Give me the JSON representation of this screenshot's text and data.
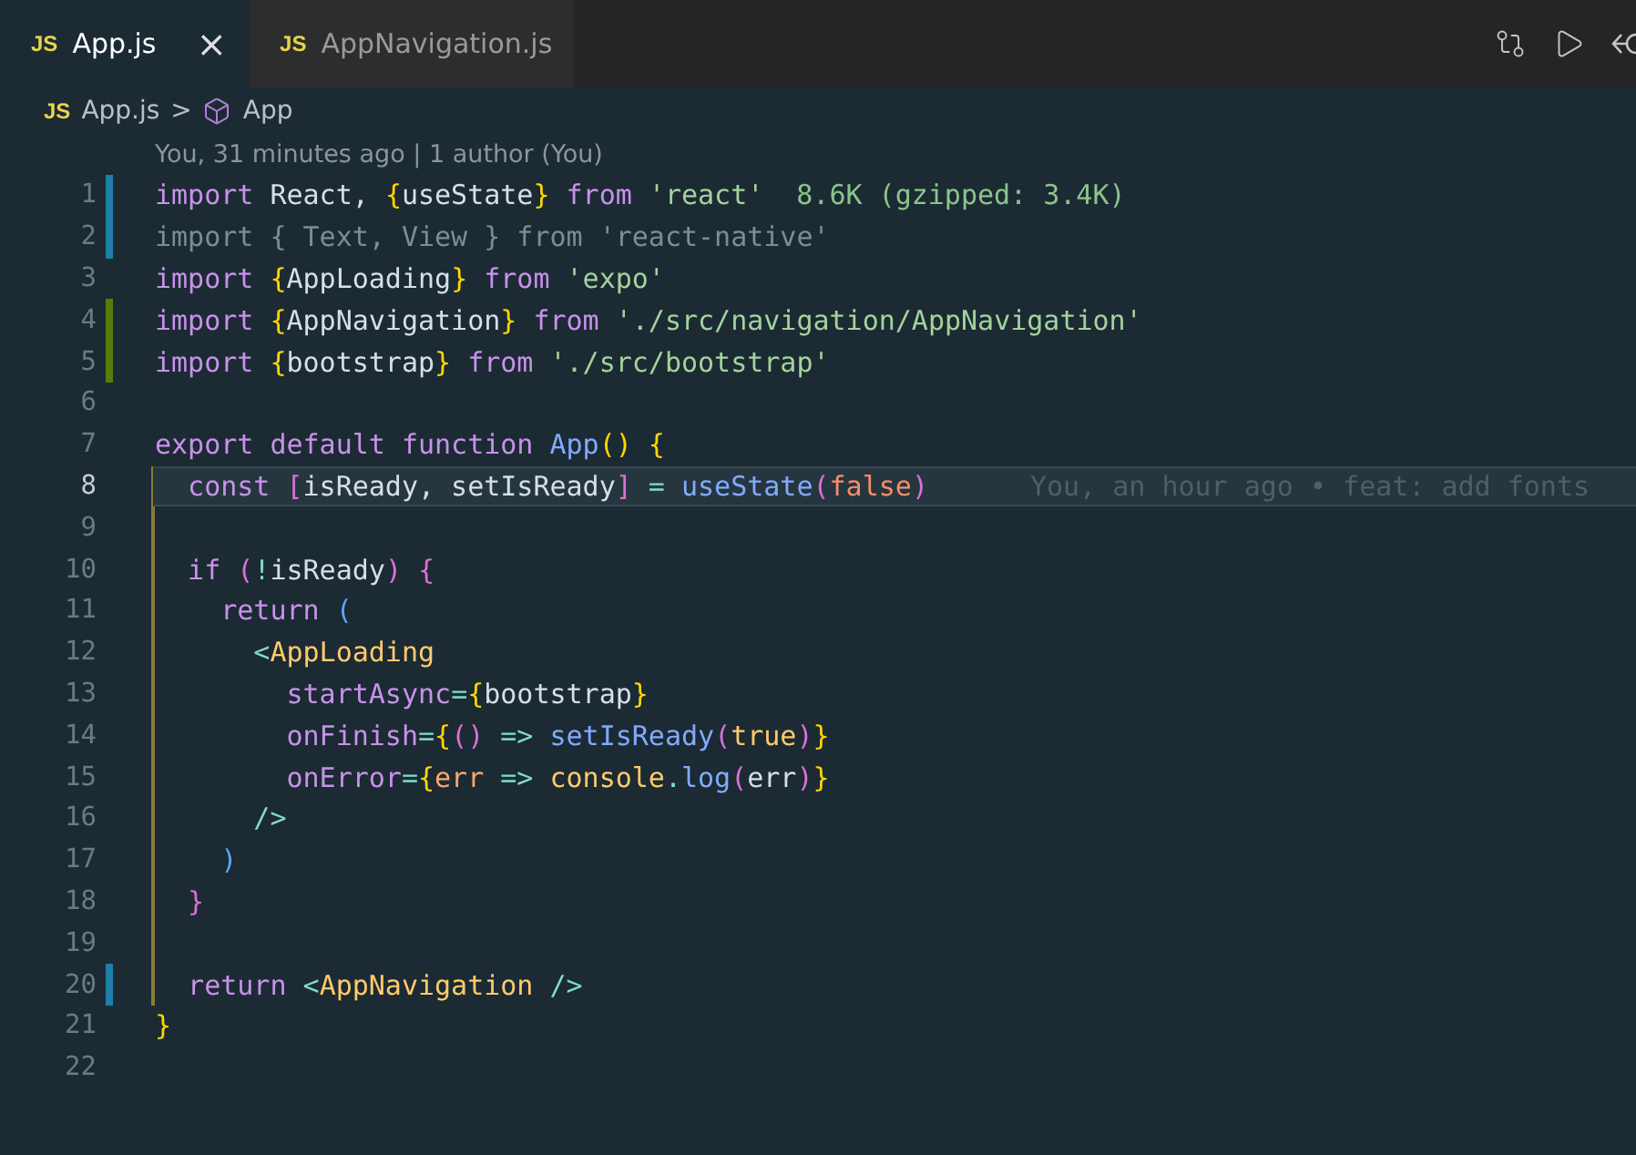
{
  "tabs": [
    {
      "icon_text": "JS",
      "label": "App.js",
      "selected": true,
      "close": "×"
    },
    {
      "icon_text": "JS",
      "label": "AppNavigation.js",
      "selected": false
    }
  ],
  "breadcrumb": {
    "file_icon_text": "JS",
    "file": "App.js",
    "separator": ">",
    "symbol": "App"
  },
  "blame_header": "You, 31 minutes ago | 1 author (You)",
  "lines": [
    {
      "number": "1",
      "modified": true,
      "added": false,
      "current": false,
      "guide": false,
      "tokens": [
        {
          "kind": "kw",
          "text": "import "
        },
        {
          "kind": "plain",
          "text": "React, "
        },
        {
          "kind": "brace",
          "text": "{"
        },
        {
          "kind": "plain",
          "text": "useState"
        },
        {
          "kind": "brace",
          "text": "}"
        },
        {
          "kind": "kw",
          "text": " from "
        },
        {
          "kind": "string",
          "text": "'react'"
        }
      ],
      "annotation": "8.6K (gzipped: 3.4K)"
    },
    {
      "number": "2",
      "modified": true,
      "added": false,
      "current": false,
      "guide": false,
      "tokens": [
        {
          "kind": "dim",
          "text": "import { Text, View } from 'react-native'"
        }
      ]
    },
    {
      "number": "3",
      "modified": false,
      "added": false,
      "current": false,
      "guide": false,
      "tokens": [
        {
          "kind": "kw",
          "text": "import "
        },
        {
          "kind": "brace",
          "text": "{"
        },
        {
          "kind": "plain",
          "text": "AppLoading"
        },
        {
          "kind": "brace",
          "text": "}"
        },
        {
          "kind": "kw",
          "text": " from "
        },
        {
          "kind": "string",
          "text": "'expo'"
        }
      ]
    },
    {
      "number": "4",
      "modified": false,
      "added": true,
      "current": false,
      "guide": false,
      "tokens": [
        {
          "kind": "kw",
          "text": "import "
        },
        {
          "kind": "brace",
          "text": "{"
        },
        {
          "kind": "plain",
          "text": "AppNavigation"
        },
        {
          "kind": "brace",
          "text": "}"
        },
        {
          "kind": "kw",
          "text": " from "
        },
        {
          "kind": "string",
          "text": "'./src/navigation/AppNavigation'"
        }
      ]
    },
    {
      "number": "5",
      "modified": false,
      "added": true,
      "current": false,
      "guide": false,
      "tokens": [
        {
          "kind": "kw",
          "text": "import "
        },
        {
          "kind": "brace",
          "text": "{"
        },
        {
          "kind": "plain",
          "text": "bootstrap"
        },
        {
          "kind": "brace",
          "text": "}"
        },
        {
          "kind": "kw",
          "text": " from "
        },
        {
          "kind": "string",
          "text": "'./src/bootstrap'"
        }
      ]
    },
    {
      "number": "6",
      "modified": false,
      "added": false,
      "current": false,
      "guide": false
    },
    {
      "number": "7",
      "modified": false,
      "added": false,
      "current": false,
      "guide": false,
      "tokens": [
        {
          "kind": "kw",
          "text": "export default function "
        },
        {
          "kind": "fn",
          "text": "App"
        },
        {
          "kind": "brace",
          "text": "() {"
        }
      ]
    },
    {
      "number": "8",
      "modified": false,
      "added": false,
      "current": true,
      "guide": true,
      "tokens": [
        {
          "kind": "kw",
          "text": "  const "
        },
        {
          "kind": "bracket2",
          "text": "["
        },
        {
          "kind": "plain",
          "text": "isReady, setIsReady"
        },
        {
          "kind": "bracket2",
          "text": "]"
        },
        {
          "kind": "punct",
          "text": " = "
        },
        {
          "kind": "fn",
          "text": "useState"
        },
        {
          "kind": "bracket2",
          "text": "("
        },
        {
          "kind": "bool",
          "text": "false"
        },
        {
          "kind": "bracket2",
          "text": ")"
        }
      ],
      "annotation": "You, an hour ago • feat: add fonts"
    },
    {
      "number": "9",
      "modified": false,
      "added": false,
      "current": false,
      "guide": true
    },
    {
      "number": "10",
      "modified": false,
      "added": false,
      "current": false,
      "guide": true,
      "tokens": [
        {
          "kind": "kw",
          "text": "  if "
        },
        {
          "kind": "bracket2",
          "text": "("
        },
        {
          "kind": "punct",
          "text": "!"
        },
        {
          "kind": "plain",
          "text": "isReady"
        },
        {
          "kind": "bracket2",
          "text": ") {"
        }
      ]
    },
    {
      "number": "11",
      "modified": false,
      "added": false,
      "current": false,
      "guide": true,
      "tokens": [
        {
          "kind": "kw",
          "text": "    return "
        },
        {
          "kind": "bracket3",
          "text": "("
        }
      ]
    },
    {
      "number": "12",
      "modified": false,
      "added": false,
      "current": false,
      "guide": true,
      "tokens": [
        {
          "kind": "punct",
          "text": "      <"
        },
        {
          "kind": "tag",
          "text": "AppLoading"
        }
      ]
    },
    {
      "number": "13",
      "modified": false,
      "added": false,
      "current": false,
      "guide": true,
      "tokens": [
        {
          "kind": "attr",
          "text": "        startAsync"
        },
        {
          "kind": "punct",
          "text": "="
        },
        {
          "kind": "brace",
          "text": "{"
        },
        {
          "kind": "plain",
          "text": "bootstrap"
        },
        {
          "kind": "brace",
          "text": "}"
        }
      ]
    },
    {
      "number": "14",
      "modified": false,
      "added": false,
      "current": false,
      "guide": true,
      "tokens": [
        {
          "kind": "attr",
          "text": "        onFinish"
        },
        {
          "kind": "punct",
          "text": "="
        },
        {
          "kind": "brace",
          "text": "{"
        },
        {
          "kind": "bracket2",
          "text": "()"
        },
        {
          "kind": "punct",
          "text": " => "
        },
        {
          "kind": "fn",
          "text": "setIsReady"
        },
        {
          "kind": "bracket2",
          "text": "("
        },
        {
          "kind": "tag",
          "text": "true"
        },
        {
          "kind": "bracket2",
          "text": ")"
        },
        {
          "kind": "brace",
          "text": "}"
        }
      ]
    },
    {
      "number": "15",
      "modified": false,
      "added": false,
      "current": false,
      "guide": true,
      "tokens": [
        {
          "kind": "attr",
          "text": "        onError"
        },
        {
          "kind": "punct",
          "text": "="
        },
        {
          "kind": "brace",
          "text": "{"
        },
        {
          "kind": "var",
          "text": "err"
        },
        {
          "kind": "punct",
          "text": " => "
        },
        {
          "kind": "tag",
          "text": "console"
        },
        {
          "kind": "punct",
          "text": "."
        },
        {
          "kind": "fn",
          "text": "log"
        },
        {
          "kind": "bracket2",
          "text": "("
        },
        {
          "kind": "plain",
          "text": "err"
        },
        {
          "kind": "bracket2",
          "text": ")"
        },
        {
          "kind": "brace",
          "text": "}"
        }
      ]
    },
    {
      "number": "16",
      "modified": false,
      "added": false,
      "current": false,
      "guide": true,
      "tokens": [
        {
          "kind": "punct",
          "text": "      />"
        }
      ]
    },
    {
      "number": "17",
      "modified": false,
      "added": false,
      "current": false,
      "guide": true,
      "tokens": [
        {
          "kind": "bracket3",
          "text": "    )"
        }
      ]
    },
    {
      "number": "18",
      "modified": false,
      "added": false,
      "current": false,
      "guide": true,
      "tokens": [
        {
          "kind": "bracket2",
          "text": "  }"
        }
      ]
    },
    {
      "number": "19",
      "modified": false,
      "added": false,
      "current": false,
      "guide": true
    },
    {
      "number": "20",
      "modified": true,
      "added": false,
      "current": false,
      "guide": true,
      "tokens": [
        {
          "kind": "kw",
          "text": "  return "
        },
        {
          "kind": "punct",
          "text": "<"
        },
        {
          "kind": "tag",
          "text": "AppNavigation"
        },
        {
          "kind": "punct",
          "text": " />"
        }
      ]
    },
    {
      "number": "21",
      "modified": false,
      "added": false,
      "current": false,
      "guide": false,
      "tokens": [
        {
          "kind": "brace",
          "text": "}"
        }
      ]
    },
    {
      "number": "22",
      "modified": false,
      "added": false,
      "current": false,
      "guide": false
    }
  ]
}
